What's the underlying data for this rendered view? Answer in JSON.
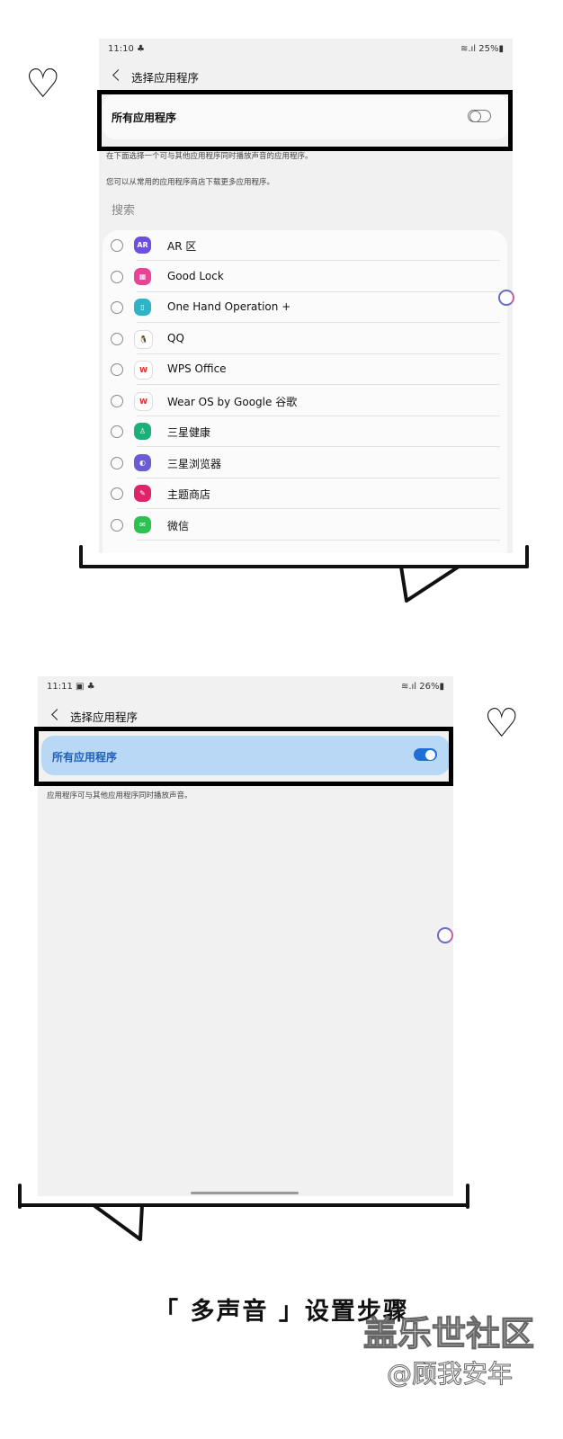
{
  "screen1": {
    "status": {
      "time": "11:10 ♣",
      "right": "≋.ıl 25%▮"
    },
    "title": "选择应用程序",
    "master_label": "所有应用程序",
    "master_on": false,
    "desc1": "在下面选择一个可与其他应用程序同时播放声音的应用程序。",
    "desc2": "您可以从常用的应用程序商店下载更多应用程序。",
    "search_placeholder": "搜索",
    "apps": [
      {
        "name": "AR 区",
        "icon": "ar-zone-icon",
        "glyph": "AR",
        "color": "#6b4fe0"
      },
      {
        "name": "Good Lock",
        "icon": "good-lock-icon",
        "glyph": "▦",
        "color": "#e84394"
      },
      {
        "name": "One Hand Operation +",
        "icon": "one-hand-operation-icon",
        "glyph": "▯",
        "color": "#2fb3c6"
      },
      {
        "name": "QQ",
        "icon": "qq-penguin-icon",
        "glyph": "🐧",
        "color": "#ffffff"
      },
      {
        "name": "WPS Office",
        "icon": "wps-office-icon",
        "glyph": "W",
        "color": "#ffffff"
      },
      {
        "name": "Wear OS by Google 谷歌",
        "icon": "wear-os-icon",
        "glyph": "W",
        "color": "#ffffff"
      },
      {
        "name": "三星健康",
        "icon": "samsung-health-icon",
        "glyph": "♙",
        "color": "#1bb07a"
      },
      {
        "name": "三星浏览器",
        "icon": "samsung-internet-icon",
        "glyph": "◐",
        "color": "#6a5cd8"
      },
      {
        "name": "主题商店",
        "icon": "theme-store-icon",
        "glyph": "✎",
        "color": "#e0246a"
      },
      {
        "name": "微信",
        "icon": "wechat-icon",
        "glyph": "✉",
        "color": "#2dc14f"
      }
    ]
  },
  "screen2": {
    "status": {
      "time": "11:11 ▣ ♣",
      "right": "≋.ıl 26%▮"
    },
    "title": "选择应用程序",
    "master_label": "所有应用程序",
    "master_on": true,
    "desc": "应用程序可与其他应用程序同时播放声音。"
  },
  "footer": {
    "title": "「 多声音 」设置步骤",
    "watermark_brand": "盖乐世社区",
    "watermark_author": "@顾我安年"
  },
  "colors": {
    "accent": "#1f6fd6",
    "highlight": "#b9d8f5",
    "panel_bg": "#f1f1f1"
  }
}
